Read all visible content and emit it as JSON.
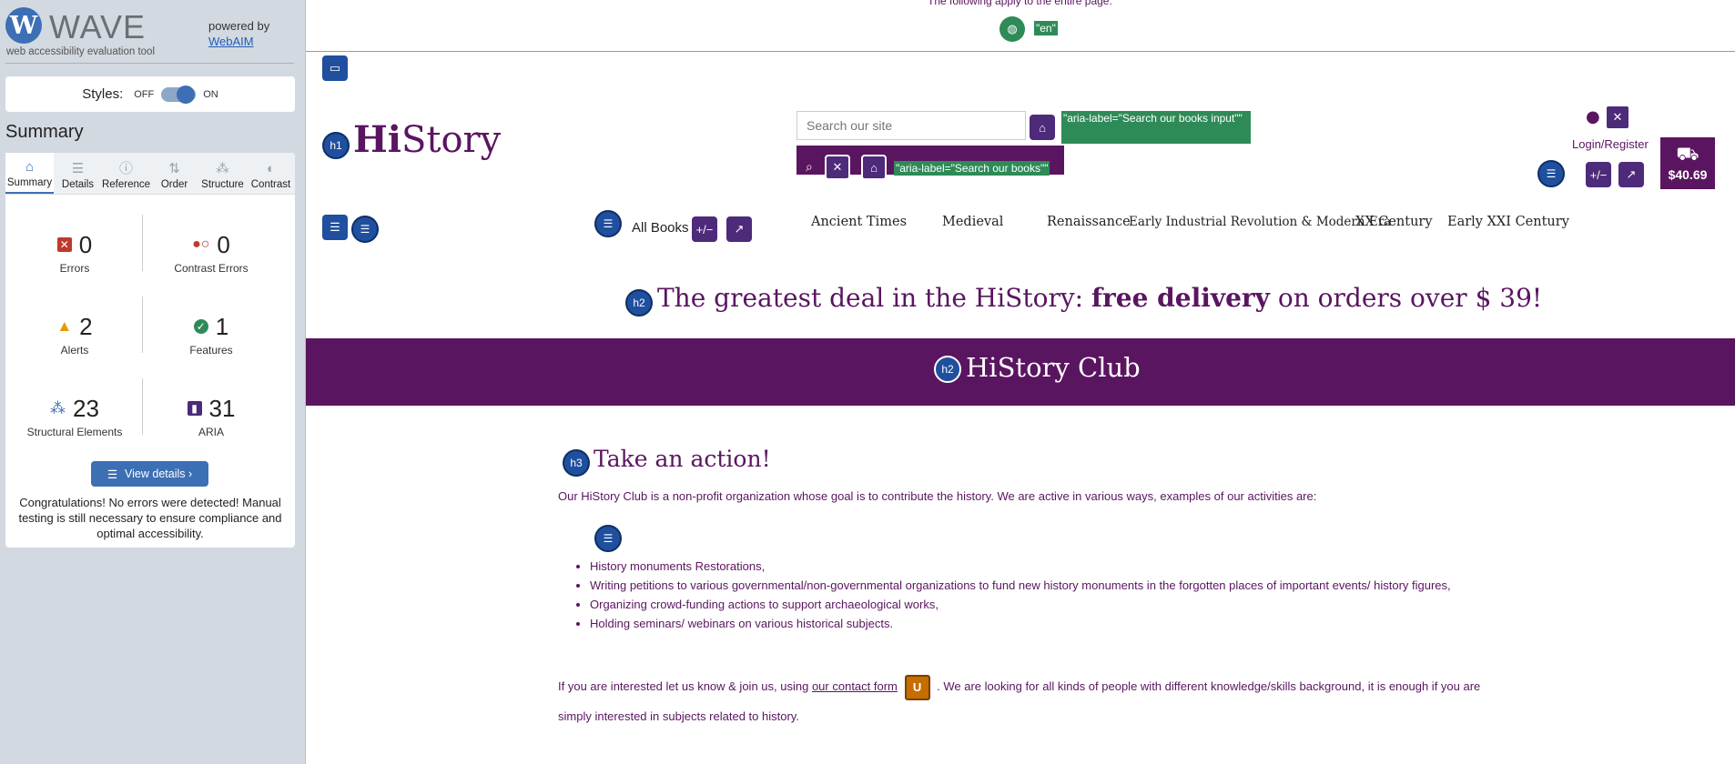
{
  "wave": {
    "logo_text": "WAVE",
    "logo_glyph": "W",
    "tagline": "web accessibility evaluation tool",
    "powered_by": "powered by",
    "webaim_link": "WebAIM",
    "styles_label": "Styles:",
    "styles_off": "OFF",
    "styles_on": "ON",
    "styles_state": "on",
    "summary_title": "Summary",
    "tabs": [
      {
        "label": "Summary",
        "icon": "home-icon",
        "active": true
      },
      {
        "label": "Details",
        "icon": "list-icon",
        "active": false
      },
      {
        "label": "Reference",
        "icon": "info-icon",
        "active": false
      },
      {
        "label": "Order",
        "icon": "order-icon",
        "active": false
      },
      {
        "label": "Structure",
        "icon": "structure-icon",
        "active": false
      },
      {
        "label": "Contrast",
        "icon": "contrast-icon",
        "active": false
      }
    ],
    "stats": {
      "errors": {
        "count": "0",
        "label": "Errors",
        "color": "#c0392b"
      },
      "contrast": {
        "count": "0",
        "label": "Contrast Errors",
        "color": "#c0392b"
      },
      "alerts": {
        "count": "2",
        "label": "Alerts",
        "color": "#e59a00"
      },
      "features": {
        "count": "1",
        "label": "Features",
        "color": "#2e8b57"
      },
      "structural": {
        "count": "23",
        "label": "Structural Elements",
        "color": "#3c6fb4"
      },
      "aria": {
        "count": "31",
        "label": "ARIA",
        "color": "#4d2a7a"
      }
    },
    "view_details": "View details ›",
    "congrats": "Congratulations! No errors were detected! Manual testing is still necessary to ensure compliance and optimal accessibility."
  },
  "site": {
    "page_note": "The following apply to the entire page.",
    "lang_tag": "\"en\"",
    "brand_bold": "Hi",
    "brand_rest": "Story",
    "search_placeholder": "Search our site",
    "aria_search_input": "\"aria-label=\"Search our books input\"\"",
    "aria_search_btn": "\"aria-label=\"Search our books\"\"",
    "login": "Login/Register",
    "cart_total": "$40.69",
    "all_books": "All Books",
    "nav": [
      "Ancient Times",
      "Medieval",
      "Renaissance",
      "Early Industrial Revolution & Modern Era",
      "XX Century",
      "Early XXI Century"
    ],
    "deal_pre": "The greatest deal in the HiStory:",
    "deal_bold": "free delivery",
    "deal_post": "on orders over $ 39!",
    "club_title": "HiStory Club",
    "action_title": "Take an action!",
    "intro": "Our HiStory Club is a non-profit organization whose goal is to contribute the history. We are active in various ways, examples of our activities are:",
    "activities": [
      "History monuments Restorations,",
      "Writing petitions to various governmental/non-governmental organizations to fund new history monuments in the forgotten places of important events/ history figures,",
      "Organizing crowd-funding actions to support archaeological works,",
      "Holding seminars/ webinars on various historical subjects."
    ],
    "contact_pre": "If you are interested let us know & join us, using",
    "contact_link": "our contact form",
    "contact_post": ". We are looking for all kinds of people with different knowledge/skills background, it is enough if you are simply interested in subjects related to history.",
    "colors": {
      "brand_purple": "#5a1560",
      "wave_blue": "#1f4f9e",
      "aria_green": "#2e8b57"
    },
    "wave_icons": {
      "h1": "h1",
      "h2": "h2",
      "h3": "h3",
      "list": "☰",
      "toggle": "+/−",
      "alert": "U"
    }
  }
}
